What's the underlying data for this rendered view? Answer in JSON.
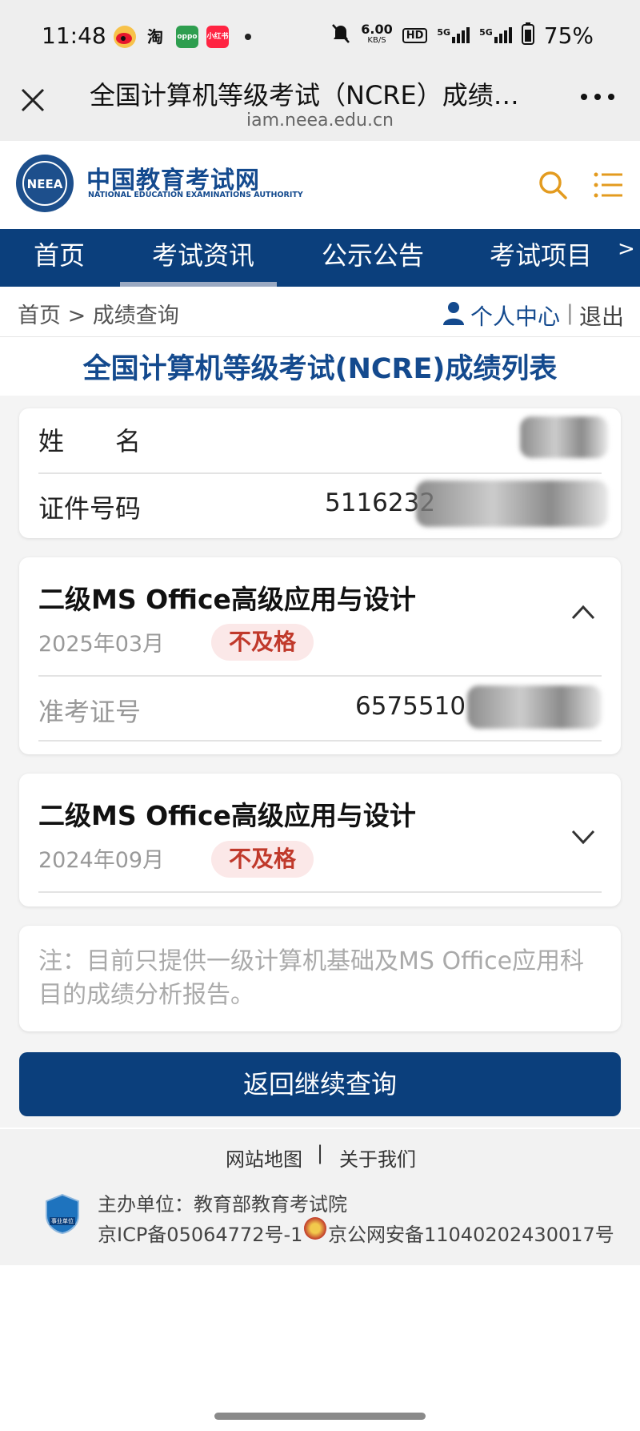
{
  "status_bar": {
    "time": "11:48",
    "apps": [
      "weibo-icon",
      "taobao-icon",
      "oppo-icon",
      "xiaohongshu-icon"
    ],
    "taobao_text": "淘",
    "oppo_text": "oppo",
    "xhs_text": "小红书",
    "net_speed": "6.00",
    "net_unit": "KB/S",
    "hd": "HD",
    "signal_1": "5G",
    "signal_2": "5G",
    "battery": "75%"
  },
  "browser": {
    "title": "全国计算机等级考试（NCRE）成绩…",
    "url": "iam.neea.edu.cn"
  },
  "site": {
    "logo_text": "NEEA",
    "name_cn": "中国教育考试网",
    "name_en": "NATIONAL EDUCATION EXAMINATIONS AUTHORITY"
  },
  "nav": {
    "items": [
      "首页",
      "考试资讯",
      "公示公告",
      "考试项目"
    ],
    "more": ">"
  },
  "breadcrumb": "首页 > 成绩查询",
  "user": {
    "center": "个人中心",
    "separator": "|",
    "logout": "退出"
  },
  "page_title": "全国计算机等级考试(NCRE)成绩列表",
  "identity": {
    "name_label": "姓　　名",
    "id_label": "证件号码",
    "id_value": "5116232"
  },
  "exams": [
    {
      "title": "二级MS Office高级应用与设计",
      "date": "2025年03月",
      "result": "不及格",
      "ticket_label": "准考证号",
      "ticket_value": "6575510"
    },
    {
      "title": "二级MS Office高级应用与设计",
      "date": "2024年09月",
      "result": "不及格"
    }
  ],
  "note": "注：目前只提供一级计算机基础及MS Office应用科目的成绩分析报告。",
  "back_button": "返回继续查询",
  "footer": {
    "link_sitemap": "网站地图",
    "link_sep": "|",
    "link_about": "关于我们",
    "host": "主办单位：教育部教育考试院",
    "icp": "京ICP备05064772号-1",
    "police": "京公网安备11040202430017号",
    "badge_text": "事业单位"
  },
  "colors": {
    "brand_blue": "#0b3f7c",
    "title_blue": "#144a8e",
    "fail_red": "#c0392b",
    "accent_orange": "#e39b1f"
  }
}
